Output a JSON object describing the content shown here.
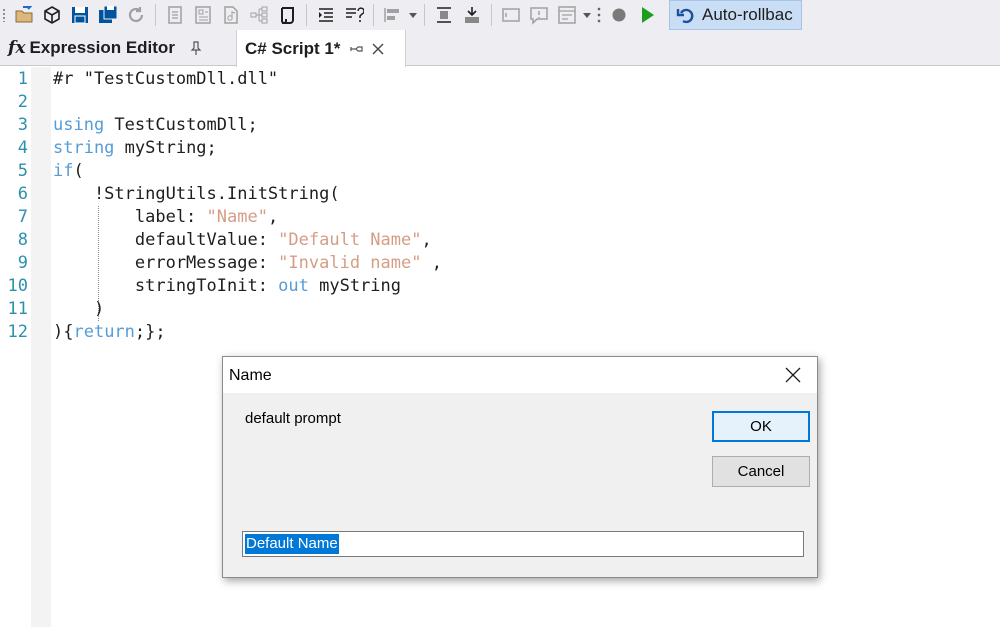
{
  "toolbar": {
    "auto_rollback_label": "Auto-rollbac"
  },
  "tabs": [
    {
      "label": "Expression Editor",
      "prefix": "fx"
    },
    {
      "label": "C# Script 1*"
    }
  ],
  "editor": {
    "line_numbers": [
      "1",
      "2",
      "3",
      "4",
      "5",
      "6",
      "7",
      "8",
      "9",
      "10",
      "11",
      "12"
    ]
  },
  "dialog": {
    "title": "Name",
    "prompt": "default prompt",
    "ok_label": "OK",
    "cancel_label": "Cancel",
    "input_value": "Default Name"
  },
  "colors": {
    "keyword": "#569cd6",
    "string": "#d69d85",
    "line_number": "#2b91af",
    "accent": "#0078d7",
    "rollback_bg": "#c9def5"
  }
}
